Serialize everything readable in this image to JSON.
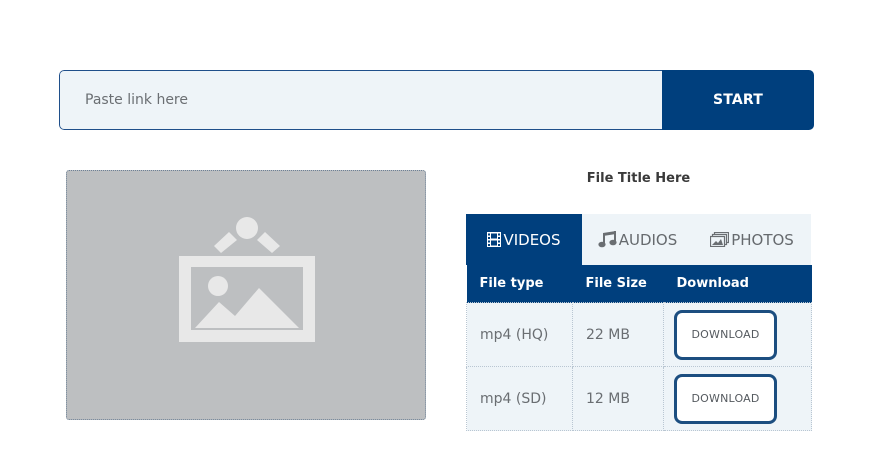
{
  "search": {
    "placeholder": "Paste link here",
    "button_label": "START"
  },
  "thumbnail": {
    "icon": "image-placeholder-icon"
  },
  "file_title": "File Title Here",
  "tabs": [
    {
      "label": "VIDEOS",
      "icon": "film-icon",
      "active": true
    },
    {
      "label": "AUDIOS",
      "icon": "music-note-icon",
      "active": false
    },
    {
      "label": "PHOTOS",
      "icon": "photos-icon",
      "active": false
    }
  ],
  "table": {
    "headers": [
      "File type",
      "File Size",
      "Download"
    ],
    "rows": [
      {
        "type": "mp4 (HQ)",
        "size": "22 MB",
        "action": "DOWNLOAD"
      },
      {
        "type": "mp4 (SD)",
        "size": "12 MB",
        "action": "DOWNLOAD"
      }
    ]
  },
  "colors": {
    "primary": "#003f7d",
    "input_bg": "#eef4f8",
    "thumbnail_bg": "#bdbfc1",
    "button_border": "#1c4e80"
  }
}
